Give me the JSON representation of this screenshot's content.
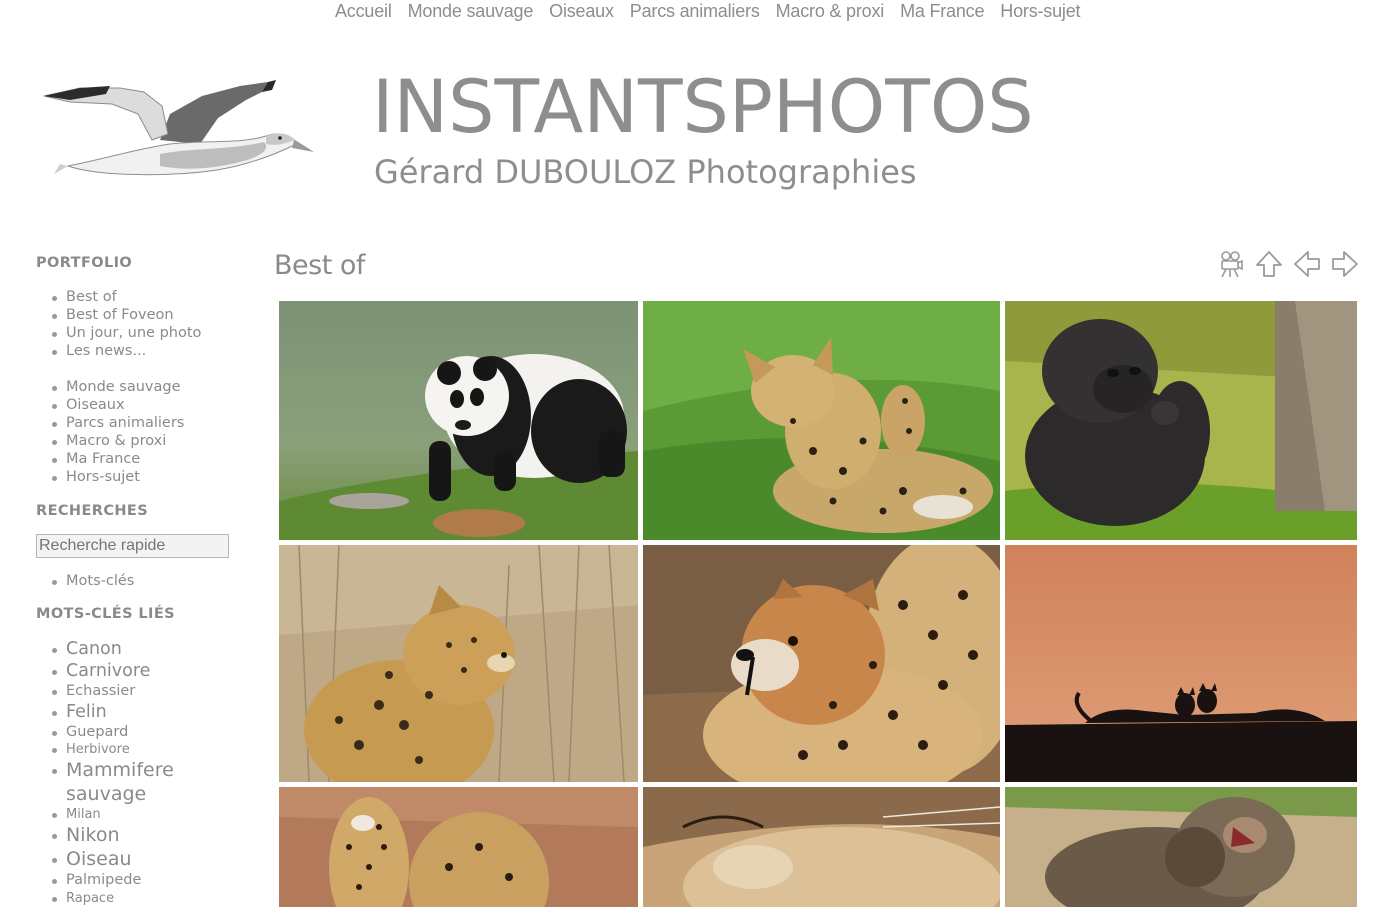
{
  "topnav": {
    "items": [
      "Accueil",
      "Monde sauvage",
      "Oiseaux",
      "Parcs animaliers",
      "Macro & proxi",
      "Ma France",
      "Hors-sujet"
    ]
  },
  "header": {
    "title": "INSTANTSPHOTOS",
    "subtitle": "Gérard DUBOULOZ Photographies",
    "logo_icon": "gannet-bird-logo"
  },
  "sidebar": {
    "portfolio_heading": "PORTFOLIO",
    "portfolio_items": [
      "Best of",
      "Best of Foveon",
      "Un jour, une photo",
      "Les news..."
    ],
    "category_items": [
      "Monde sauvage",
      "Oiseaux",
      "Parcs animaliers",
      "Macro & proxi",
      "Ma France",
      "Hors-sujet"
    ],
    "search_heading": "RECHERCHES",
    "search_placeholder": "Recherche rapide",
    "search_links": [
      "Mots-clés"
    ],
    "tags_heading": "MOTS-CLÉS LIÉS",
    "tags": [
      "Canon",
      "Carnivore",
      "Echassier",
      "Felin",
      "Guepard",
      "Herbivore",
      "Mammifere sauvage",
      "Milan",
      "Nikon",
      "Oiseau",
      "Palmipede",
      "Rapace"
    ]
  },
  "main": {
    "title": "Best of",
    "toolbar_icons": [
      "slideshow-icon",
      "up-arrow-icon",
      "previous-arrow-icon",
      "next-arrow-icon"
    ]
  },
  "colors": {
    "text": "#8a8a8a",
    "background": "#ffffff"
  }
}
